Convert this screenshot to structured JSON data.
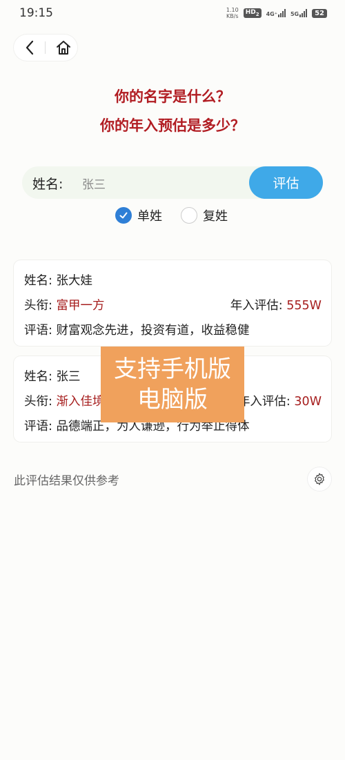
{
  "status_bar": {
    "time": "19:15",
    "net_speed_value": "1.10",
    "net_speed_unit": "KB/s",
    "hd_label": "HD",
    "hd_sub": "2",
    "signal_4g_label": "4G⁺",
    "signal_5g_label": "5G",
    "battery": "52"
  },
  "header": {
    "title_line1": "你的名字是什么？",
    "title_line2": "你的年入预估是多少？"
  },
  "form": {
    "name_label": "姓名:",
    "name_value": "张三",
    "evaluate_button": "评估",
    "option_single": "单姓",
    "option_double": "复姓",
    "selected": "单姓"
  },
  "results": [
    {
      "name_label": "姓名:",
      "name": "张大娃",
      "title_label": "头衔:",
      "title": "富甲一方",
      "income_label": "年入评估:",
      "income": "555W",
      "comment_label": "评语:",
      "comment": "财富观念先进，投资有道，收益稳健"
    },
    {
      "name_label": "姓名:",
      "name": "张三",
      "title_label": "头衔:",
      "title": "渐入佳境",
      "income_label": "年入评估:",
      "income": "30W",
      "comment_label": "评语:",
      "comment": "品德端正，为人谦逊，行为举止得体"
    }
  ],
  "overlay": {
    "line1": "支持手机版",
    "line2": "电脑版"
  },
  "footer": {
    "disclaimer": "此评估结果仅供参考"
  },
  "icons": {
    "back": "chevron-left-icon",
    "home": "home-icon",
    "check": "check-icon",
    "settings": "gear-icon"
  },
  "colors": {
    "title_red": "#b11c22",
    "value_red": "#a61e1e",
    "button_blue": "#3fa9e8",
    "radio_blue": "#2f7fd6",
    "overlay_orange": "#f0a15c"
  }
}
